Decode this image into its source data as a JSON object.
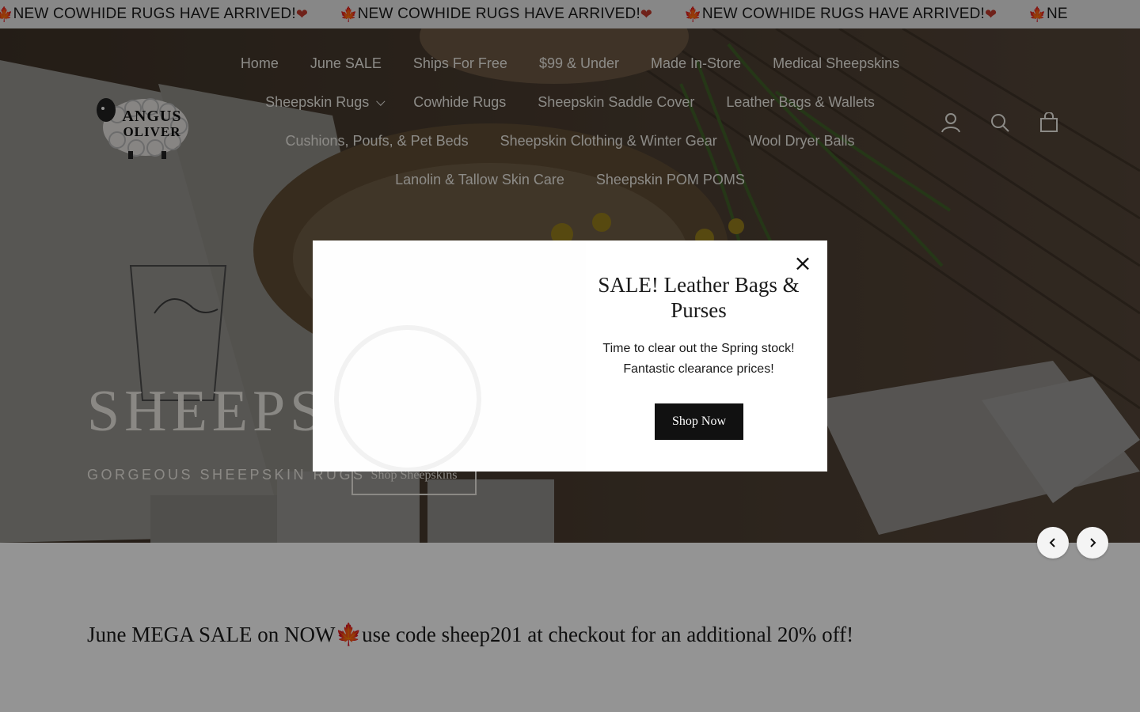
{
  "announcement": {
    "items": [
      "NEW COWHIDE RUGS HAVE ARRIVED!",
      "NEW COWHIDE RUGS HAVE ARRIVED!",
      "NEW COWHIDE RUGS HAVE ARRIVED!",
      "NE"
    ],
    "leaf": "🍁",
    "heart": "❤"
  },
  "header": {
    "logo_text_line1": "ANGUS",
    "logo_text_line2": "OLIVER",
    "nav": [
      [
        "Home",
        "June SALE",
        "Ships For Free",
        "$99 & Under",
        "Made In-Store",
        "Medical Sheepskins"
      ],
      [
        "Sheepskin Rugs",
        "Cowhide Rugs",
        "Sheepskin Saddle Cover",
        "Leather Bags & Wallets"
      ],
      [
        "Cushions, Poufs, & Pet Beds",
        "Sheepskin Clothing & Winter Gear",
        "Wool Dryer Balls"
      ],
      [
        "Lanolin & Tallow Skin Care",
        "Sheepskin POM POMS"
      ]
    ],
    "icons": [
      "account-icon",
      "search-icon",
      "cart-icon"
    ]
  },
  "hero": {
    "title": "SHEEPSKIN SALE",
    "subtitle": "GORGEOUS SHEEPSKIN RUGS",
    "button_label": "Shop Sheepskins"
  },
  "promo": {
    "text_before": "June MEGA SALE on NOW",
    "leaf": "🍁",
    "text_after": "use code sheep201 at checkout for an additional 20% off!"
  },
  "modal": {
    "title": "SALE! Leather Bags & Purses",
    "body": "Time to clear out the Spring stock! Fantastic clearance prices!",
    "button_label": "Shop Now",
    "close_glyph": "×"
  },
  "colors": {
    "announce_bg": "#e9e9e9",
    "accent_red": "#c0392b",
    "button_dark": "#111111"
  }
}
